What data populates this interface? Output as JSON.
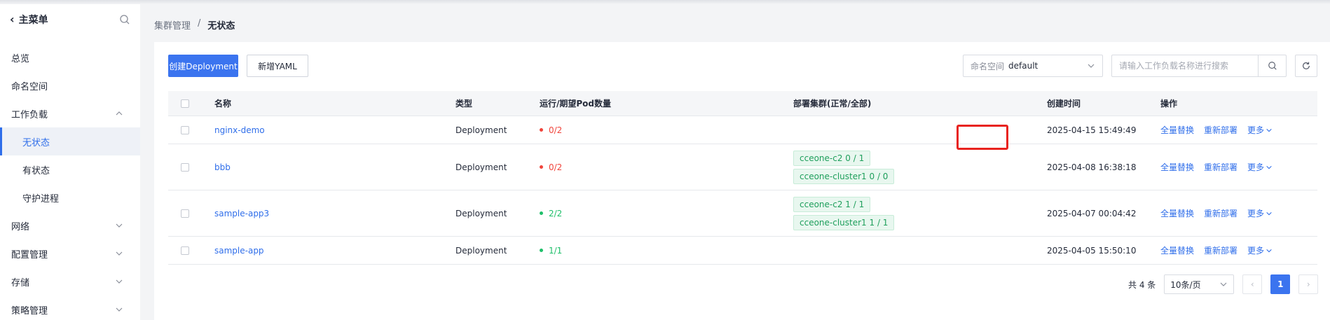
{
  "sidebar": {
    "title": "主菜单",
    "items": [
      {
        "label": "总览",
        "sub": false,
        "chevron": ""
      },
      {
        "label": "命名空间",
        "sub": false,
        "chevron": ""
      },
      {
        "label": "工作负载",
        "sub": false,
        "chevron": "up"
      },
      {
        "label": "无状态",
        "sub": true,
        "active": true,
        "chevron": ""
      },
      {
        "label": "有状态",
        "sub": true,
        "chevron": ""
      },
      {
        "label": "守护进程",
        "sub": true,
        "chevron": ""
      },
      {
        "label": "网络",
        "sub": false,
        "chevron": "down"
      },
      {
        "label": "配置管理",
        "sub": false,
        "chevron": "down"
      },
      {
        "label": "存储",
        "sub": false,
        "chevron": "down"
      },
      {
        "label": "策略管理",
        "sub": false,
        "chevron": "down"
      }
    ]
  },
  "breadcrumb": {
    "parent": "集群管理",
    "separator": "/",
    "current": "无状态"
  },
  "toolbar": {
    "create_label": "创建Deployment",
    "yaml_label": "新增YAML",
    "ns_label": "命名空间",
    "ns_value": "default",
    "search_placeholder": "请输入工作负载名称进行搜索"
  },
  "table": {
    "headers": [
      "名称",
      "类型",
      "运行/期望Pod数量",
      "部署集群(正常/全部)",
      "创建时间",
      "操作"
    ],
    "rows": [
      {
        "name": "nginx-demo",
        "type": "Deployment",
        "pods": "0/2",
        "status": "error",
        "clusters": [],
        "created": "2025-04-15 15:49:49"
      },
      {
        "name": "bbb",
        "type": "Deployment",
        "pods": "0/2",
        "status": "error",
        "clusters": [
          "cceone-c2   0 / 1",
          "cceone-cluster1   0 / 0"
        ],
        "created": "2025-04-08 16:38:18"
      },
      {
        "name": "sample-app3",
        "type": "Deployment",
        "pods": "2/2",
        "status": "ok",
        "clusters": [
          "cceone-c2   1 / 1",
          "cceone-cluster1   1 / 1"
        ],
        "created": "2025-04-07 00:04:42"
      },
      {
        "name": "sample-app",
        "type": "Deployment",
        "pods": "1/1",
        "status": "ok",
        "clusters": [],
        "created": "2025-04-05 15:50:10"
      }
    ],
    "actions": {
      "replace": "全量替换",
      "redeploy": "重新部署",
      "more": "更多"
    }
  },
  "pagination": {
    "total": "共 4 条",
    "page_size": "10条/页",
    "current_page": "1"
  },
  "colors": {
    "primary": "#3b74ef",
    "error": "#f0443b",
    "ok": "#1fbf6a",
    "highlight": "#e8231f"
  }
}
